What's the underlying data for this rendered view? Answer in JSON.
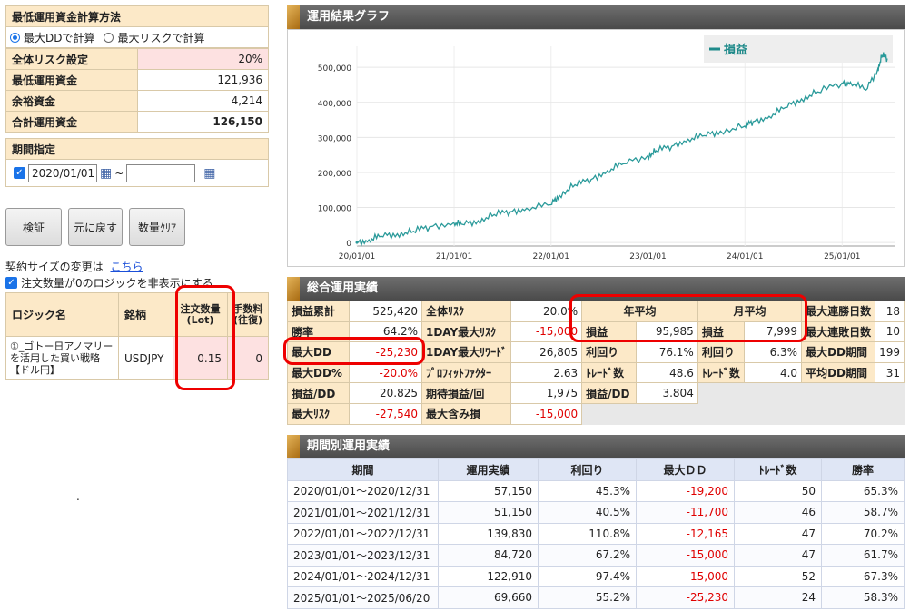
{
  "left": {
    "calc_method_title": "最低運用資金計算方法",
    "radio_dd": "最大DDで計算",
    "radio_risk": "最大リスクで計算",
    "rows": [
      {
        "label": "全体リスク設定",
        "value": "20%"
      },
      {
        "label": "最低運用資金",
        "value": "121,936"
      },
      {
        "label": "余裕資金",
        "value": "4,214"
      },
      {
        "label": "合計運用資金",
        "value": "126,150"
      }
    ],
    "period_title": "期間指定",
    "date_from": "2020/01/01",
    "tilde": "~",
    "date_to": "",
    "buttons": {
      "verify": "検証",
      "reset": "元に戻す",
      "qty_clear": "数量ｸﾘｱ"
    },
    "contract_change": "契約サイズの変更は",
    "contract_link": "こちら",
    "hide_zero": "注文数量が0のロジックを非表示にする",
    "logic_table": {
      "headers": [
        "ロジック名",
        "銘柄",
        "注文数量(Lot)",
        "手数料(往復)"
      ],
      "rows": [
        {
          "name": "①_ゴトー日アノマリーを活用した買い戦略【ドル円】",
          "symbol": "USDJPY",
          "qty": "0.15",
          "fee": "0"
        }
      ]
    },
    "dot": "."
  },
  "graph": {
    "title": "運用結果グラフ",
    "legend": "損益"
  },
  "chart_data": {
    "type": "line",
    "series": [
      {
        "name": "損益",
        "points": [
          [
            "2020/01/01",
            0
          ],
          [
            "2020/02/15",
            8000
          ],
          [
            "2020/04/01",
            18000
          ],
          [
            "2020/06/01",
            25000
          ],
          [
            "2020/08/01",
            32000
          ],
          [
            "2020/10/01",
            45000
          ],
          [
            "2020/12/31",
            57000
          ],
          [
            "2021/02/01",
            52000
          ],
          [
            "2021/04/01",
            62000
          ],
          [
            "2021/06/01",
            80000
          ],
          [
            "2021/08/01",
            88000
          ],
          [
            "2021/10/01",
            98000
          ],
          [
            "2021/12/31",
            108000
          ],
          [
            "2022/02/01",
            135000
          ],
          [
            "2022/04/01",
            165000
          ],
          [
            "2022/06/01",
            180000
          ],
          [
            "2022/08/01",
            205000
          ],
          [
            "2022/10/01",
            225000
          ],
          [
            "2022/12/31",
            248000
          ],
          [
            "2023/02/01",
            262000
          ],
          [
            "2023/04/01",
            275000
          ],
          [
            "2023/06/01",
            295000
          ],
          [
            "2023/08/01",
            305000
          ],
          [
            "2023/10/01",
            318000
          ],
          [
            "2023/12/31",
            332000
          ],
          [
            "2024/02/01",
            345000
          ],
          [
            "2024/04/01",
            360000
          ],
          [
            "2024/06/01",
            385000
          ],
          [
            "2024/08/01",
            410000
          ],
          [
            "2024/10/01",
            430000
          ],
          [
            "2024/12/31",
            455000
          ],
          [
            "2025/02/01",
            458000
          ],
          [
            "2025/04/01",
            435000
          ],
          [
            "2025/05/15",
            495000
          ],
          [
            "2025/06/01",
            535000
          ],
          [
            "2025/06/20",
            525000
          ]
        ]
      }
    ],
    "y_ticks": [
      0,
      100000,
      200000,
      300000,
      400000,
      500000
    ],
    "y_tick_labels": [
      "0",
      "100,000",
      "200,000",
      "300,000",
      "400,000",
      "500,000"
    ],
    "x_tick_labels": [
      "20/01/01",
      "21/01/01",
      "22/01/01",
      "23/01/01",
      "24/01/01",
      "25/01/01"
    ],
    "ylim": [
      -10000,
      560000
    ],
    "grid": true,
    "legend_position": "top-right",
    "line_color": "#2a9a9a"
  },
  "summary": {
    "title": "総合運用実績",
    "col1": [
      {
        "k": "損益累計",
        "v": "525,420"
      },
      {
        "k": "勝率",
        "v": "64.2%"
      },
      {
        "k": "最大DD",
        "v": "-25,230"
      },
      {
        "k": "最大DD%",
        "v": "-20.0%"
      },
      {
        "k": "損益/DD",
        "v": "20.825"
      },
      {
        "k": "最大ﾘｽｸ",
        "v": "-27,540"
      }
    ],
    "col2": [
      {
        "k": "全体ﾘｽｸ",
        "v": "20.0%"
      },
      {
        "k": "1DAY最大ﾘｽｸ",
        "v": "-15,000"
      },
      {
        "k": "1DAY最大ﾘﾜｰﾄﾞ",
        "v": "26,805"
      },
      {
        "k": "ﾌﾟﾛﾌｨｯﾄﾌｧｸﾀｰ",
        "v": "2.63"
      },
      {
        "k": "期待損益/回",
        "v": "1,975"
      },
      {
        "k": "最大含み損",
        "v": "-15,000"
      }
    ],
    "year_avg": "年平均",
    "month_avg": "月平均",
    "col3": [
      {
        "k": "損益",
        "v": "95,985"
      },
      {
        "k": "利回り",
        "v": "76.1%"
      },
      {
        "k": "ﾄﾚｰﾄﾞ数",
        "v": "48.6"
      },
      {
        "k": "損益/DD",
        "v": "3.804"
      }
    ],
    "col4": [
      {
        "k": "損益",
        "v": "7,999"
      },
      {
        "k": "利回り",
        "v": "6.3%"
      },
      {
        "k": "ﾄﾚｰﾄﾞ数",
        "v": "4.0"
      }
    ],
    "col5": [
      {
        "k": "最大連勝日数",
        "v": "18"
      },
      {
        "k": "最大連敗日数",
        "v": "10"
      },
      {
        "k": "最大DD期間",
        "v": "199"
      },
      {
        "k": "平均DD期間",
        "v": "31"
      }
    ]
  },
  "period_perf": {
    "title": "期間別運用実績",
    "headers": [
      "期間",
      "運用実績",
      "利回り",
      "最大ＤＤ",
      "ﾄﾚｰﾄﾞ数",
      "勝率"
    ],
    "rows": [
      [
        "2020/01/01～2020/12/31",
        "57,150",
        "45.3%",
        "-19,200",
        "50",
        "65.3%"
      ],
      [
        "2021/01/01～2021/12/31",
        "51,150",
        "40.5%",
        "-11,700",
        "46",
        "58.7%"
      ],
      [
        "2022/01/01～2022/12/31",
        "139,830",
        "110.8%",
        "-12,165",
        "47",
        "70.2%"
      ],
      [
        "2023/01/01～2023/12/31",
        "84,720",
        "67.2%",
        "-15,000",
        "47",
        "61.7%"
      ],
      [
        "2024/01/01～2024/12/31",
        "122,910",
        "97.4%",
        "-15,000",
        "52",
        "67.3%"
      ],
      [
        "2025/01/01～2025/06/20",
        "69,660",
        "55.2%",
        "-25,230",
        "24",
        "58.3%"
      ]
    ]
  }
}
